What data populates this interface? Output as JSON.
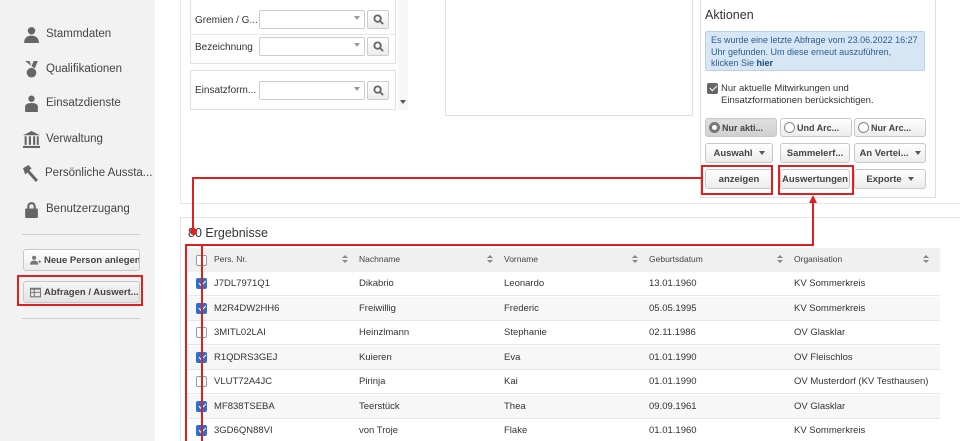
{
  "sidebar": {
    "items": [
      {
        "label": "Stammdaten",
        "icon": "person-icon"
      },
      {
        "label": "Qualifikationen",
        "icon": "medal-icon"
      },
      {
        "label": "Einsatzdienste",
        "icon": "person-badge-icon"
      },
      {
        "label": "Verwaltung",
        "icon": "building-icon"
      },
      {
        "label": "Persönliche Aussta...",
        "icon": "hammer-icon"
      },
      {
        "label": "Benutzerzugang",
        "icon": "lock-icon"
      }
    ],
    "new_person_label": "Neue Person anlegen",
    "queries_label": "Abfragen / Auswert..."
  },
  "filters": {
    "gremien_label": "Gremien / G...",
    "bezeichnung_label": "Bezeichnung",
    "einsatzform_label": "Einsatzform..."
  },
  "actions": {
    "title": "Aktionen",
    "info_text": "Es wurde eine letzte Abfrage vom 23.06.2022 16:27 Uhr gefunden. Um diese erneut auszuführen, klicken Sie",
    "info_link": "hier",
    "current_only_label": "Nur aktuelle Mitwirkungen und Einsatzformationen berücksichtigen.",
    "radio_1": "Nur akti...",
    "radio_2": "Und Arc...",
    "radio_3": "Nur Arc...",
    "auswahl_label": "Auswahl",
    "sammel_label": "Sammelerf...",
    "verteiler_label": "An Vertei...",
    "anzeigen_label": "anzeigen",
    "auswertungen_label": "Auswertungen",
    "exporte_label": "Exporte"
  },
  "results": {
    "title": "80 Ergebnisse",
    "columns": [
      "Pers. Nr.",
      "Nachname",
      "Vorname",
      "Geburtsdatum",
      "Organisation"
    ],
    "rows": [
      {
        "checked": true,
        "pers_nr": "J7DL7971Q1",
        "nachname": "Dikabrio",
        "vorname": "Leonardo",
        "geburtsdatum": "13.01.1960",
        "organisation": "KV Sommerkreis"
      },
      {
        "checked": true,
        "pers_nr": "M2R4DW2HH6",
        "nachname": "Freiwillig",
        "vorname": "Frederic",
        "geburtsdatum": "05.05.1995",
        "organisation": "KV Sommerkreis"
      },
      {
        "checked": false,
        "pers_nr": "3MITL02LAI",
        "nachname": "Heinzlmann",
        "vorname": "Stephanie",
        "geburtsdatum": "02.11.1986",
        "organisation": "OV Glasklar"
      },
      {
        "checked": true,
        "pers_nr": "R1QDRS3GEJ",
        "nachname": "Kuieren",
        "vorname": "Eva",
        "geburtsdatum": "01.01.1990",
        "organisation": "OV Fleischlos"
      },
      {
        "checked": false,
        "pers_nr": "VLUT72A4JC",
        "nachname": "Pirinja",
        "vorname": "Kai",
        "geburtsdatum": "01.01.1990",
        "organisation": "OV Musterdorf (KV Testhausen)"
      },
      {
        "checked": true,
        "pers_nr": "MF838TSEBA",
        "nachname": "Teerstück",
        "vorname": "Thea",
        "geburtsdatum": "09.09.1961",
        "organisation": "OV Glasklar"
      },
      {
        "checked": true,
        "pers_nr": "3GD6QN88VI",
        "nachname": "von Troje",
        "vorname": "Flake",
        "geburtsdatum": "01.01.1960",
        "organisation": "KV Sommerkreis"
      }
    ]
  },
  "colors": {
    "annotation": "#e02020",
    "checkbox": "#2b6fd1",
    "info_bg": "#d6e6f5"
  }
}
